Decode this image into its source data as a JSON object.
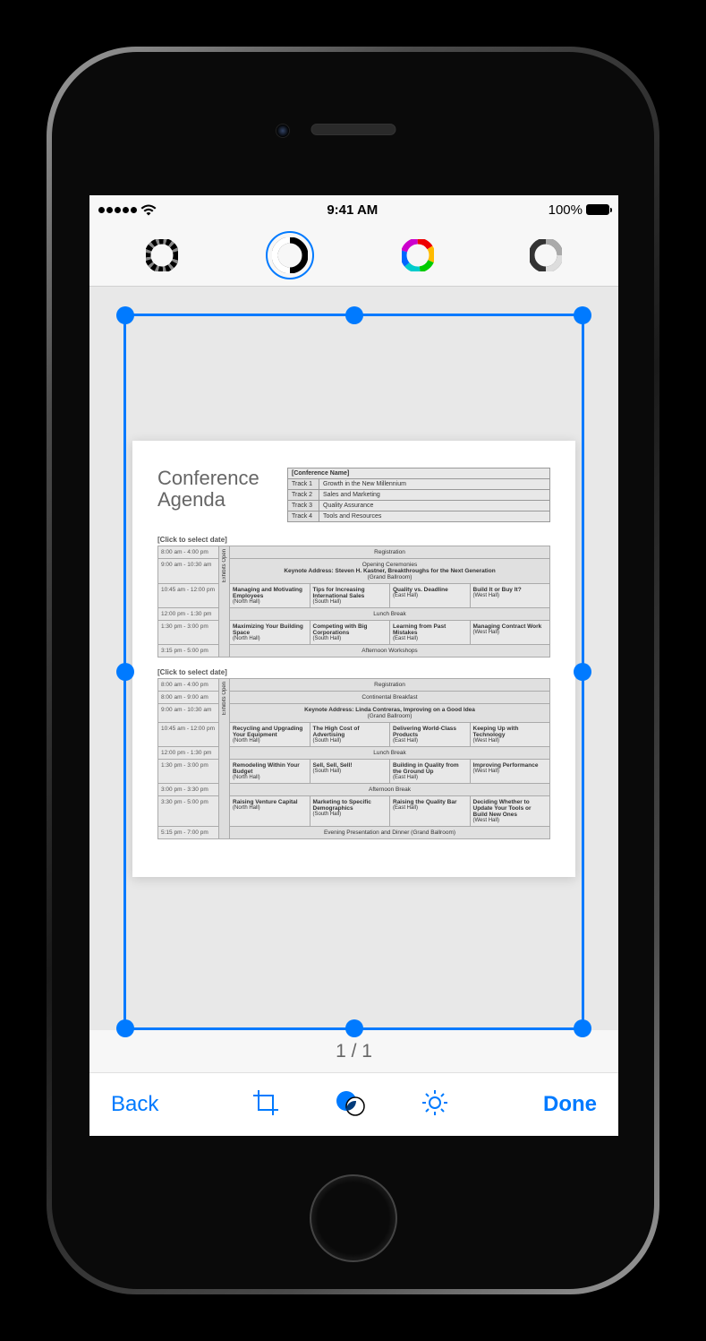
{
  "status": {
    "time": "9:41 AM",
    "battery": "100%"
  },
  "page_counter": "1 / 1",
  "bottom": {
    "back": "Back",
    "done": "Done"
  },
  "document": {
    "title_line1": "Conference",
    "title_line2": "Agenda",
    "conference_name_label": "[Conference Name]",
    "tracks": [
      {
        "label": "Track 1",
        "desc": "Growth in the New Millennium"
      },
      {
        "label": "Track 2",
        "desc": "Sales and Marketing"
      },
      {
        "label": "Track 3",
        "desc": "Quality Assurance"
      },
      {
        "label": "Track 4",
        "desc": "Tools and Resources"
      }
    ],
    "day1": {
      "date_label": "[Click to select date]",
      "exhibits_label": "Exhibits Open",
      "rows": {
        "r0": {
          "time": "8:00 am - 4:00 pm",
          "text": "Registration"
        },
        "r1": {
          "time": "9:00 am - 10:30 am",
          "line1": "Opening Ceremonies",
          "line2": "Keynote Address: Steven H. Kastner, Breakthroughs for the Next Generation",
          "line3": "(Grand Ballroom)"
        },
        "r2": {
          "time": "10:45 am - 12:00 pm",
          "c1": {
            "t": "Managing and Motivating Employees",
            "loc": "(North Hall)"
          },
          "c2": {
            "t": "Tips for Increasing International Sales",
            "loc": "(South Hall)"
          },
          "c3": {
            "t": "Quality vs. Deadline",
            "loc": "(East Hall)"
          },
          "c4": {
            "t": "Build It or Buy It?",
            "loc": "(West Hall)"
          }
        },
        "r3": {
          "time": "12:00 pm - 1:30 pm",
          "text": "Lunch Break"
        },
        "r4": {
          "time": "1:30 pm - 3:00 pm",
          "c1": {
            "t": "Maximizing Your Building Space",
            "loc": "(North Hall)"
          },
          "c2": {
            "t": "Competing with Big Corporations",
            "loc": "(South Hall)"
          },
          "c3": {
            "t": "Learning from Past Mistakes",
            "loc": "(East Hall)"
          },
          "c4": {
            "t": "Managing Contract Work",
            "loc": "(West Hall)"
          }
        },
        "r5": {
          "time": "3:15 pm - 5:00 pm",
          "text": "Afternoon Workshops"
        }
      }
    },
    "day2": {
      "date_label": "[Click to select date]",
      "exhibits_label": "Exhibits Open",
      "rows": {
        "r0": {
          "time": "8:00 am - 4:00 pm",
          "text": "Registration"
        },
        "r1": {
          "time": "8:00 am - 9:00 am",
          "text": "Continental Breakfast"
        },
        "r2": {
          "time": "9:00 am - 10:30 am",
          "line1": "Keynote Address: Linda Contreras, Improving on a Good Idea",
          "line2": "(Grand Ballroom)"
        },
        "r3": {
          "time": "10:45 am - 12:00 pm",
          "c1": {
            "t": "Recycling and Upgrading Your Equipment",
            "loc": "(North Hall)"
          },
          "c2": {
            "t": "The High Cost of Advertising",
            "loc": "(South Hall)"
          },
          "c3": {
            "t": "Delivering World-Class Products",
            "loc": "(East Hall)"
          },
          "c4": {
            "t": "Keeping Up with Technology",
            "loc": "(West Hall)"
          }
        },
        "r4": {
          "time": "12:00 pm - 1:30 pm",
          "text": "Lunch Break"
        },
        "r5": {
          "time": "1:30 pm - 3:00 pm",
          "c1": {
            "t": "Remodeling Within Your Budget",
            "loc": "(North Hall)"
          },
          "c2": {
            "t": "Sell, Sell, Sell!",
            "loc": "(South Hall)"
          },
          "c3": {
            "t": "Building in Quality from the Ground Up",
            "loc": "(East Hall)"
          },
          "c4": {
            "t": "Improving Performance",
            "loc": "(West Hall)"
          }
        },
        "r6": {
          "time": "3:00 pm - 3:30 pm",
          "text": "Afternoon Break"
        },
        "r7": {
          "time": "3:30 pm - 5:00 pm",
          "c1": {
            "t": "Raising Venture Capital",
            "loc": "(North Hall)"
          },
          "c2": {
            "t": "Marketing to Specific Demographics",
            "loc": "(South Hall)"
          },
          "c3": {
            "t": "Raising the Quality Bar",
            "loc": "(East Hall)"
          },
          "c4": {
            "t": "Deciding Whether to Update Your Tools or Build New Ones",
            "loc": "(West Hall)"
          }
        },
        "r8": {
          "time": "5:15 pm - 7:00 pm",
          "text": "Evening Presentation and Dinner (Grand Ballroom)"
        }
      }
    }
  }
}
